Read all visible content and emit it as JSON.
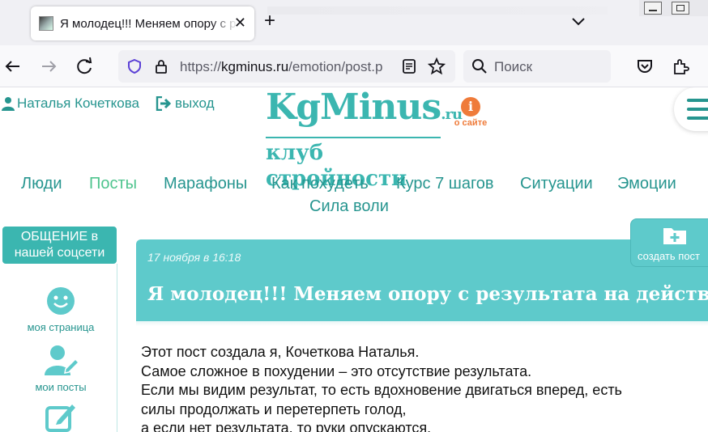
{
  "browser": {
    "tab_title": "Я молодец!!! Меняем опору с результата на действие",
    "url_prefix": "https://",
    "url_domain": "kgminus.ru",
    "url_path": "/emotion/post.p",
    "search_placeholder": "Поиск"
  },
  "header": {
    "user_name": "Наталья Кочеткова",
    "logout_label": "выход",
    "logo_main": "KgMinus",
    "logo_tld": ".ru",
    "logo_sub": "клуб стройности",
    "about_label": "о сайте",
    "accent_color": "#3bb6b0"
  },
  "nav": {
    "items": [
      {
        "label": "Люди"
      },
      {
        "label": "Посты"
      },
      {
        "label": "Марафоны"
      },
      {
        "label": "Как похудеть"
      },
      {
        "label": "Курс 7 шагов"
      },
      {
        "label": "Ситуации"
      },
      {
        "label": "Эмоции"
      },
      {
        "label": "Сила воли"
      }
    ],
    "active": "Посты"
  },
  "sidebar": {
    "social_label": "ОБЩЕНИЕ в нашей соцсети",
    "items": [
      {
        "label": "моя страница",
        "icon": "smile-icon"
      },
      {
        "label": "мои посты",
        "icon": "user-edit-icon"
      },
      {
        "label": "",
        "icon": "edit-icon"
      }
    ]
  },
  "create_post": {
    "label": "создать пост"
  },
  "post": {
    "date": "17 ноября в 16:18",
    "title": "Я молодец!!! Меняем опору с результата на действие",
    "lines": [
      "Этот пост создала я, Кочеткова Наталья.",
      "Самое сложное в похудении – это отсутствие результата.",
      "Если мы видим результат, то есть вдохновение двигаться вперед, есть",
      "силы продолжать и перетерпеть голод,",
      "а если нет результата, то руки опускаются."
    ]
  }
}
